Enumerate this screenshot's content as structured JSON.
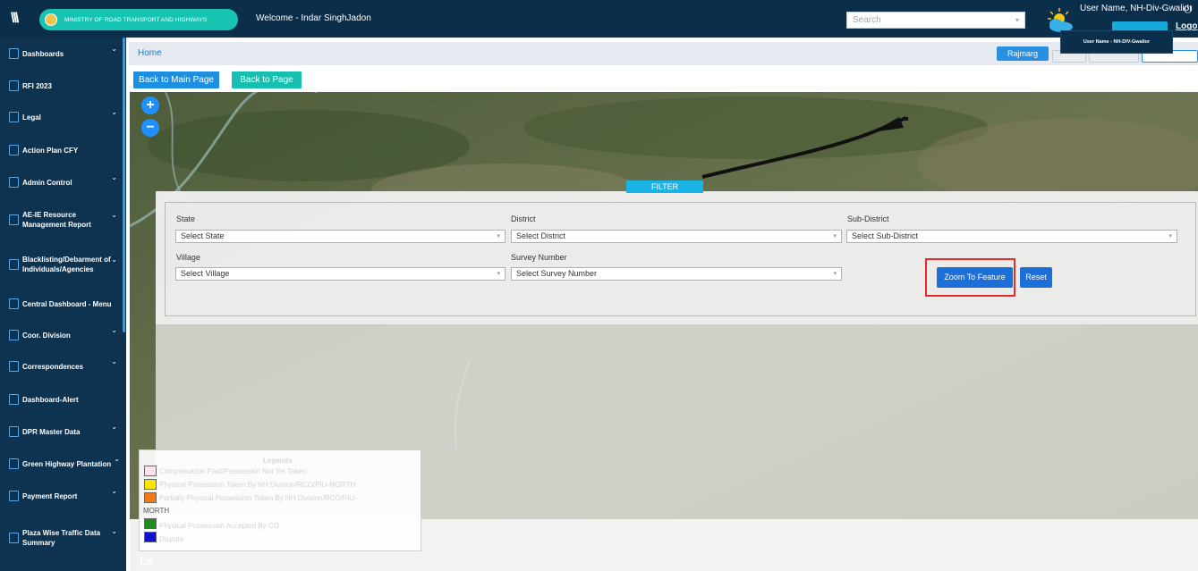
{
  "header": {
    "ministry": "MINISTRY OF ROAD TRANSPORT AND HIGHWAYS",
    "welcome": "Welcome - Indar SinghJadon",
    "search_placeholder": "Search",
    "user_name": "User Name, NH-Div-Gwalior",
    "logout": "Logo",
    "user_dropdown": "User Name - NH-DIV-Gwalior"
  },
  "sidebar": {
    "items": [
      {
        "label": "Dashboards",
        "chevron": true
      },
      {
        "label": "RFI 2023",
        "chevron": false
      },
      {
        "label": "Legal",
        "chevron": true
      },
      {
        "label": "Action Plan CFY",
        "chevron": false
      },
      {
        "label": "Admin Control",
        "chevron": true
      },
      {
        "label": "AE-IE Resource Management Report",
        "chevron": true
      },
      {
        "label": "Blacklisting/Debarment of Individuals/Agencies",
        "chevron": true
      },
      {
        "label": "Central Dashboard - Menu",
        "chevron": false
      },
      {
        "label": "Coor. Division",
        "chevron": true
      },
      {
        "label": "Correspondences",
        "chevron": true
      },
      {
        "label": "Dashboard-Alert",
        "chevron": false
      },
      {
        "label": "DPR Master Data",
        "chevron": true
      },
      {
        "label": "Green Highway Plantation",
        "chevron": true
      },
      {
        "label": "Payment Report",
        "chevron": true
      },
      {
        "label": "Plaza Wise Traffic Data Summary",
        "chevron": true
      }
    ]
  },
  "breadcrumb": {
    "home": "Home"
  },
  "toolbar": {
    "rajmarg": "Rajmarg",
    "back_main": "Back to Main Page",
    "back_page": "Back to Page"
  },
  "map": {
    "zoom_in": "+",
    "zoom_out": "−"
  },
  "filter": {
    "tab": "FILTER",
    "state_label": "State",
    "state_value": "Select State",
    "district_label": "District",
    "district_value": "Select District",
    "subdistrict_label": "Sub-District",
    "subdistrict_value": "Select Sub-District",
    "village_label": "Village",
    "village_value": "Select Village",
    "survey_label": "Survey Number",
    "survey_value": "Select Survey Number",
    "zoom_btn": "Zoom To Feature",
    "reset_btn": "Reset"
  },
  "legend": {
    "title": "Legends",
    "items": [
      {
        "label": "Compensation Paid/Possession Not Yet Taken",
        "color": "#ffe0f0"
      },
      {
        "label": "Physical Possession Taken By NH Division/RCO/PIU-MORTH",
        "color": "#ffe600"
      },
      {
        "label": "Partially Physical Possession Taken By NH Division/RCO/PIU-",
        "color": "#f07a1a"
      },
      {
        "label": "Physical Possession Accepted By CO",
        "color": "#1f8a1f"
      },
      {
        "label": "Dispute",
        "color": "#1010d0"
      }
    ],
    "morth": "MORTH",
    "layers": "La"
  },
  "colors": {
    "topbar": "#0b2e4a",
    "sidebar": "#0e3350",
    "accent_teal": "#17c3b2",
    "primary_blue": "#1d6fd8",
    "highlight_red": "#e32b2b"
  }
}
